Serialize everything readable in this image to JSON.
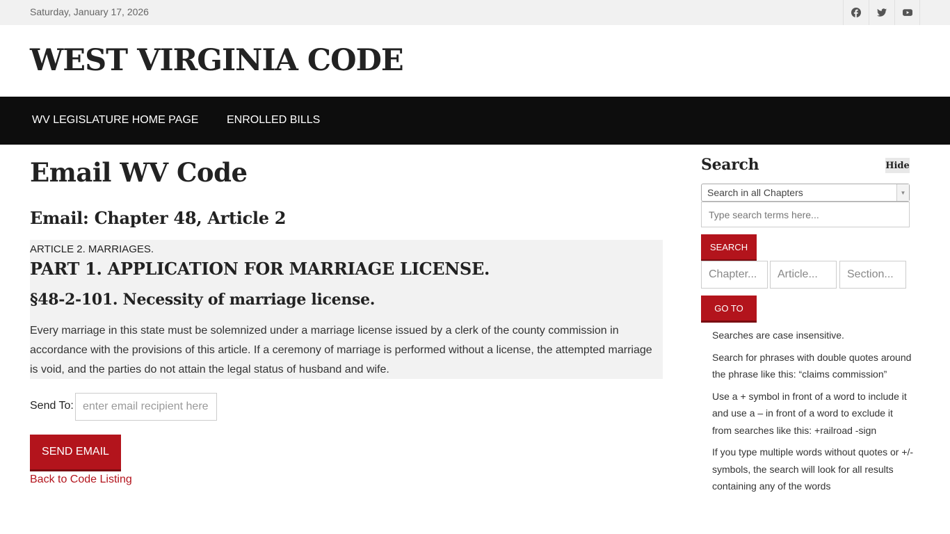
{
  "topbar": {
    "date": "Saturday, January 17, 2026",
    "social_icons": [
      "facebook-icon",
      "twitter-icon",
      "youtube-icon"
    ]
  },
  "site": {
    "title": "WEST VIRGINIA CODE"
  },
  "nav": {
    "items": [
      {
        "label": "WV LEGISLATURE HOME PAGE"
      },
      {
        "label": "ENROLLED BILLS"
      }
    ]
  },
  "main": {
    "page_title": "Email WV Code",
    "subtitle": "Email: Chapter 48, Article 2",
    "article_label": "ARTICLE 2. MARRIAGES.",
    "part_heading": "PART 1. APPLICATION FOR MARRIAGE LICENSE.",
    "section_heading": "§48-2-101. Necessity of marriage license.",
    "section_text": "Every marriage in this state must be solemnized under a marriage license issued by a clerk of the county commission in accordance with the provisions of this article. If a ceremony of marriage is performed without a license, the attempted marriage is void, and the parties do not attain the legal status of husband and wife.",
    "send_to_label": "Send To:",
    "email_placeholder": "enter email recipient here.",
    "send_button": "SEND EMAIL",
    "back_link": "Back to Code Listing"
  },
  "sidebar": {
    "title": "Search",
    "hide_label": "Hide",
    "scope_selected": "Search in all Chapters",
    "search_placeholder": "Type search terms here...",
    "search_button": "SEARCH",
    "chapter_placeholder": "Chapter...",
    "article_placeholder": "Article...",
    "section_placeholder": "Section...",
    "goto_button": "GO TO",
    "tips": [
      "Searches are case insensitive.",
      "Search for phrases with double quotes around the phrase like this: “claims commission”",
      "Use a + symbol in front of a word to include it and use a – in front of a word to exclude it from searches like this: +railroad -sign",
      "If you type multiple words without quotes or +/- symbols, the search will look for all results containing any of the words"
    ]
  },
  "colors": {
    "accent": "#b3141c",
    "navbar": "#0d0d0d",
    "topbar": "#f1f1f1"
  }
}
